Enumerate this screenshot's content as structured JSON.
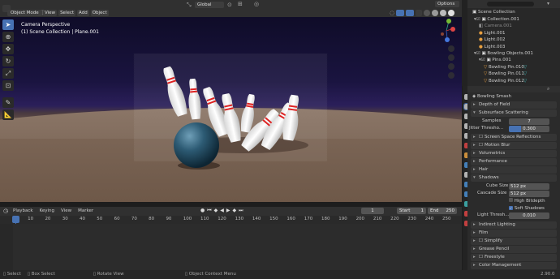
{
  "header": {
    "mode": "Object Mode",
    "menus": [
      "View",
      "Select",
      "Add",
      "Object"
    ],
    "orientation": "Global",
    "options": "Options"
  },
  "viewport": {
    "camera_label": "Camera Perspective",
    "collection_label": "(1) Scene Collection | Plane.001"
  },
  "outliner": {
    "title": "Scene Collection",
    "rows": [
      {
        "label": "Collection.001",
        "depth": 1,
        "icon": "collection-icon"
      },
      {
        "label": "Camera.001",
        "depth": 2,
        "icon": "camera-icon"
      },
      {
        "label": "Light.001",
        "depth": 2,
        "icon": "light-icon"
      },
      {
        "label": "Light.002",
        "depth": 2,
        "icon": "light-icon"
      },
      {
        "label": "Light.003",
        "depth": 2,
        "icon": "light-icon"
      },
      {
        "label": "Bowling Objects.001",
        "depth": 1,
        "icon": "collection-icon"
      },
      {
        "label": "Pins.001",
        "depth": 2,
        "icon": "collection-icon"
      },
      {
        "label": "Bowling Pin.010",
        "depth": 3,
        "icon": "mesh-icon"
      },
      {
        "label": "Bowling Pin.011",
        "depth": 3,
        "icon": "mesh-icon"
      },
      {
        "label": "Bowling Pin.012",
        "depth": 3,
        "icon": "mesh-icon"
      }
    ]
  },
  "properties": {
    "scene_name": "Bowling Smash",
    "depth_of_field": "Depth of Field",
    "subsurface": "Subsurface Scattering",
    "samples_label": "Samples",
    "samples_value": "7",
    "jitter_label": "Jitter Thresho...",
    "jitter_value": "0.300",
    "screen_space": "Screen Space Reflections",
    "motion_blur": "Motion Blur",
    "volumetrics": "Volumetrics",
    "performance": "Performance",
    "hair": "Hair",
    "shadows": "Shadows",
    "cube_size_label": "Cube Size",
    "cube_size_value": "512 px",
    "cascade_size_label": "Cascade Size",
    "cascade_size_value": "512 px",
    "high_bitdepth": "High Bitdepth",
    "soft_shadows": "Soft Shadows",
    "light_thresh_label": "Light Thresh...",
    "light_thresh_value": "0.010",
    "indirect_lighting": "Indirect Lighting",
    "film": "Film",
    "simplify": "Simplify",
    "grease_pencil": "Grease Pencil",
    "freestyle": "Freestyle",
    "color_management": "Color Management"
  },
  "timeline": {
    "menus": [
      "Playback",
      "Keying",
      "View",
      "Marker"
    ],
    "current_frame": "1",
    "start_label": "Start",
    "start_value": "1",
    "end_label": "End",
    "end_value": "250",
    "ticks": [
      "1",
      "10",
      "20",
      "30",
      "40",
      "50",
      "60",
      "70",
      "80",
      "90",
      "100",
      "110",
      "120",
      "130",
      "140",
      "150",
      "160",
      "170",
      "180",
      "190",
      "200",
      "210",
      "220",
      "230",
      "240",
      "250"
    ]
  },
  "status_bar": {
    "select": "Select",
    "box_select": "Box Select",
    "rotate_view": "Rotate View",
    "context_menu": "Object Context Menu",
    "version": "2.90.0"
  }
}
